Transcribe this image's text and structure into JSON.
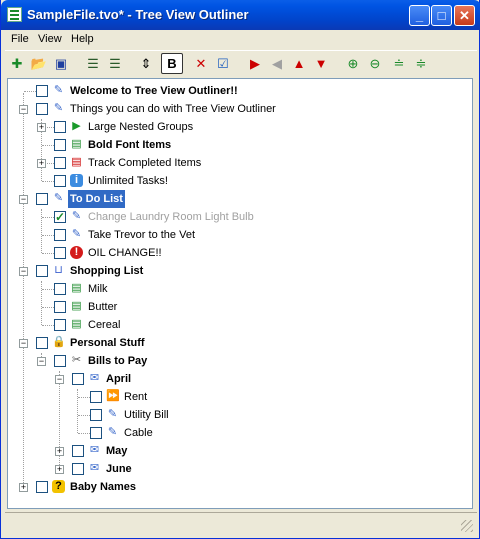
{
  "window": {
    "title": "SampleFile.tvo* - Tree View Outliner"
  },
  "menu": [
    "File",
    "View",
    "Help"
  ],
  "toolbar": {
    "bold_label": "B"
  },
  "tree": [
    {
      "label": "Welcome to Tree View Outliner!!",
      "icon": "note-icon",
      "bold": true
    },
    {
      "label": "Things you can do with Tree View Outliner",
      "icon": "note-icon",
      "bold": false
    },
    {
      "label": "Large Nested Groups",
      "icon": "play-icon",
      "bold": false
    },
    {
      "label": "Bold Font Items",
      "icon": "doc-icon",
      "bold": true
    },
    {
      "label": "Track Completed Items",
      "icon": "doc-red-icon",
      "bold": false
    },
    {
      "label": "Unlimited Tasks!",
      "icon": "info-icon",
      "bold": false
    },
    {
      "label": "To Do List",
      "icon": "note-icon",
      "bold": true,
      "selected": true
    },
    {
      "label": "Change Laundry Room Light Bulb",
      "icon": "note-icon",
      "completed": true
    },
    {
      "label": "Take Trevor to the Vet",
      "icon": "note-icon",
      "bold": false
    },
    {
      "label": "OIL CHANGE!!",
      "icon": "alert-icon",
      "bold": false
    },
    {
      "label": "Shopping List",
      "icon": "cart-icon",
      "bold": true
    },
    {
      "label": "Milk",
      "icon": "add-doc-icon",
      "bold": false
    },
    {
      "label": "Butter",
      "icon": "add-doc-icon",
      "bold": false
    },
    {
      "label": "Cereal",
      "icon": "add-doc-icon",
      "bold": false
    },
    {
      "label": "Personal Stuff",
      "icon": "lock-icon",
      "bold": true
    },
    {
      "label": "Bills to Pay",
      "icon": "scissors-icon",
      "bold": true
    },
    {
      "label": "April",
      "icon": "envelope-icon",
      "bold": true
    },
    {
      "label": "Rent",
      "icon": "fast-forward-icon",
      "bold": false
    },
    {
      "label": "Utility Bill",
      "icon": "note-icon",
      "bold": false
    },
    {
      "label": "Cable",
      "icon": "note-icon",
      "bold": false
    },
    {
      "label": "May",
      "icon": "envelope-icon",
      "bold": true
    },
    {
      "label": "June",
      "icon": "envelope-icon",
      "bold": true
    },
    {
      "label": "Baby Names",
      "icon": "question-icon",
      "bold": true
    }
  ],
  "colors": {
    "selection": "#316ac5",
    "titlebar": "#0054e3"
  }
}
